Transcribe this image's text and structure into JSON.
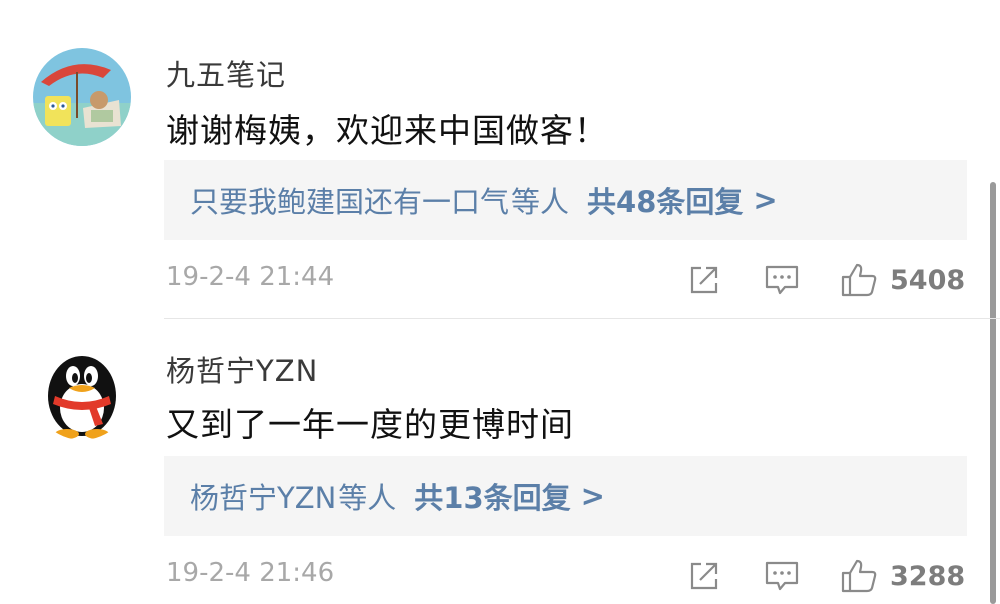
{
  "comments": [
    {
      "username": "九五笔记",
      "text": "谢谢梅姨，欢迎来中国做客！",
      "reply_names": "只要我鲍建国还有一口气",
      "reply_suffix": "等人",
      "reply_count": "共48条回复",
      "chevron": ">",
      "time": "19-2-4 21:44",
      "likes": "5408",
      "avatar_icon": "spongebob-avatar"
    },
    {
      "username": "杨哲宁YZN",
      "text": "又到了一年一度的更博时间",
      "reply_names": "杨哲宁YZN",
      "reply_suffix": "等人",
      "reply_count": "共13条回复",
      "chevron": ">",
      "time": "19-2-4 21:46",
      "likes": "3288",
      "avatar_icon": "qq-penguin-avatar"
    }
  ],
  "colors": {
    "link": "#5b7fa8",
    "reply_bg": "#f5f5f5",
    "meta_text": "#a8a8a8",
    "icon": "#8a8a8a"
  },
  "icons": [
    "share-icon",
    "comment-icon",
    "like-icon"
  ]
}
